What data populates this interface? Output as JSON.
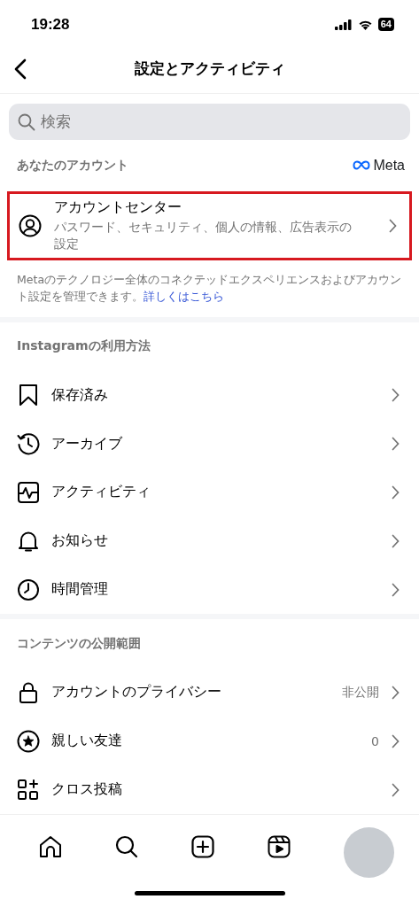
{
  "status_bar": {
    "time": "19:28",
    "battery": "64"
  },
  "header": {
    "title": "設定とアクティビティ"
  },
  "search": {
    "placeholder": "検索"
  },
  "account_section": {
    "title": "あなたのアカウント",
    "brand": "Meta",
    "account_center": {
      "title": "アカウントセンター",
      "subtitle": "パスワード、セキュリティ、個人の情報、広告表示の設定",
      "highlighted": true
    },
    "description": "Metaのテクノロジー全体のコネクテッドエクスペリエンスおよびアカウント設定を管理できます。",
    "link": "詳しくはこちら"
  },
  "sections": [
    {
      "title": "Instagramの利用方法",
      "items": [
        {
          "kind": "bookmark",
          "label": "保存済み"
        },
        {
          "kind": "archive",
          "label": "アーカイブ"
        },
        {
          "kind": "activity",
          "label": "アクティビティ"
        },
        {
          "kind": "bell",
          "label": "お知らせ"
        },
        {
          "kind": "clock",
          "label": "時間管理"
        }
      ]
    },
    {
      "title": "コンテンツの公開範囲",
      "items": [
        {
          "kind": "lock",
          "label": "アカウントのプライバシー",
          "value": "非公開"
        },
        {
          "kind": "star",
          "label": "親しい友達",
          "value": "0"
        },
        {
          "kind": "grid",
          "label": "クロス投稿"
        }
      ]
    }
  ],
  "tab_bar": [
    {
      "kind": "home"
    },
    {
      "kind": "search"
    },
    {
      "kind": "create"
    },
    {
      "kind": "reels"
    },
    {
      "kind": "profile"
    }
  ]
}
